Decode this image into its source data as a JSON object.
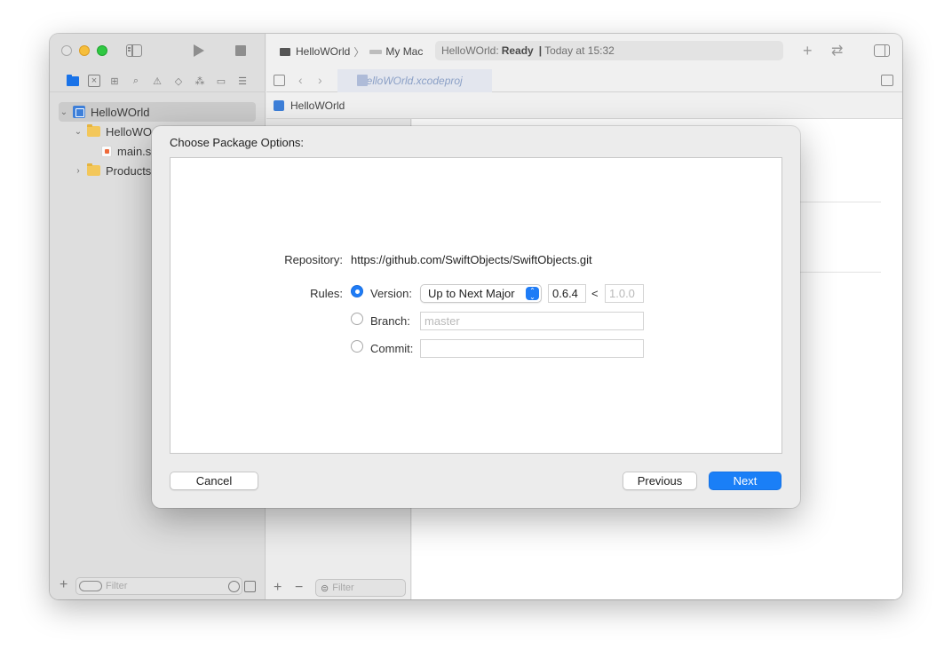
{
  "window": {
    "scheme": "HelloWOrld",
    "destination": "My Mac",
    "status": {
      "project": "HelloWOrld:",
      "state": "Ready",
      "separator": "|",
      "time": "Today at 15:32"
    }
  },
  "navigator": {
    "tree": [
      {
        "label": "HelloWOrld",
        "type": "project",
        "expanded": true
      },
      {
        "label": "HelloWO",
        "type": "folder",
        "expanded": true
      },
      {
        "label": "main.s",
        "type": "swift-file"
      },
      {
        "label": "Products",
        "type": "folder",
        "expanded": false
      }
    ],
    "filter_placeholder": "Filter"
  },
  "editor": {
    "tab_label": "HelloWOrld.xcodeproj",
    "breadcrumb": "HelloWOrld",
    "filter_placeholder": "Filter"
  },
  "sheet": {
    "title": "Choose Package Options:",
    "repository_label": "Repository:",
    "repository_url": "https://github.com/SwiftObjects/SwiftObjects.git",
    "rules_label": "Rules:",
    "version_label": "Version:",
    "version_rule": "Up to Next Major",
    "version_from": "0.6.4",
    "version_lt": "<",
    "version_to_placeholder": "1.0.0",
    "branch_label": "Branch:",
    "branch_placeholder": "master",
    "commit_label": "Commit:",
    "commit_value": "",
    "selected_rule": "version",
    "cancel": "Cancel",
    "previous": "Previous",
    "next": "Next"
  },
  "colors": {
    "accent": "#1a7ff7",
    "window_bg": "#ececec"
  }
}
